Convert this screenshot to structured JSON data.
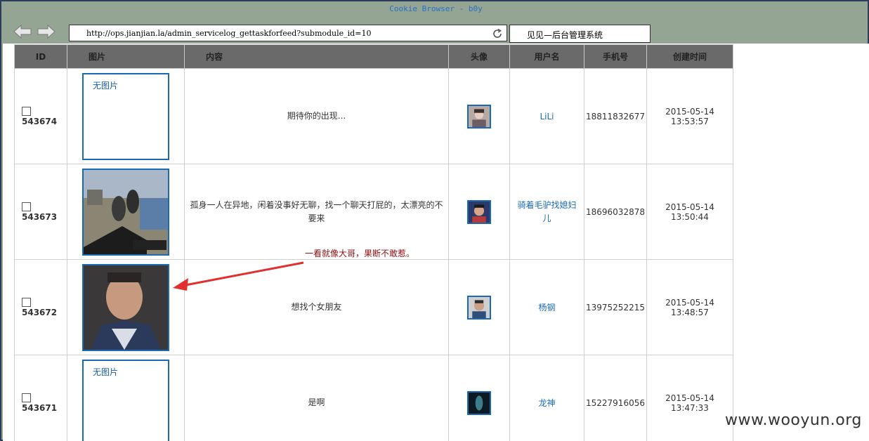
{
  "window": {
    "title": "Cookie Browser - b0y"
  },
  "toolbar": {
    "url": "http://ops.jianjian.la/admin_servicelog_gettaskforfeed?submodule_id=10",
    "page_title": "见见—后台管理系统"
  },
  "table": {
    "headers": [
      "ID",
      "图片",
      "内容",
      "头像",
      "用户名",
      "手机号",
      "创建时间"
    ],
    "rows": [
      {
        "id": "543674",
        "image": "无图片",
        "content": "期待你的出现...",
        "avatar": "avatar-photo",
        "username": "LiLi",
        "phone": "18811832677",
        "date": "2015-05-14",
        "time": "13:53:57"
      },
      {
        "id": "543673",
        "image": "photo",
        "content": "孤身一人在异地，闲着没事好无聊，找一个聊天打屁的，太漂亮的不要来",
        "avatar": "avatar-photo",
        "username": "骑着毛驴找媳妇儿",
        "phone": "18696032878",
        "date": "2015-05-14",
        "time": "13:50:44"
      },
      {
        "id": "543672",
        "image": "photo",
        "content": "想找个女朋友",
        "avatar": "avatar-photo",
        "username": "杨钢",
        "phone": "13975252215",
        "date": "2015-05-14",
        "time": "13:48:57"
      },
      {
        "id": "543671",
        "image": "无图片",
        "content": "是啊",
        "avatar": "avatar-photo",
        "username": "龙神",
        "phone": "15227916056",
        "date": "2015-05-14",
        "time": "13:47:33"
      }
    ]
  },
  "annotation": {
    "text": "一看就像大哥，果断不敢惹。"
  },
  "watermark": {
    "text": "www.wooyun.org"
  },
  "colors": {
    "window_bg": "#94a594",
    "header_bg": "#6a6a6a",
    "link": "#1a6ab1",
    "annotation": "#8b1010",
    "arrow": "#e03030"
  }
}
